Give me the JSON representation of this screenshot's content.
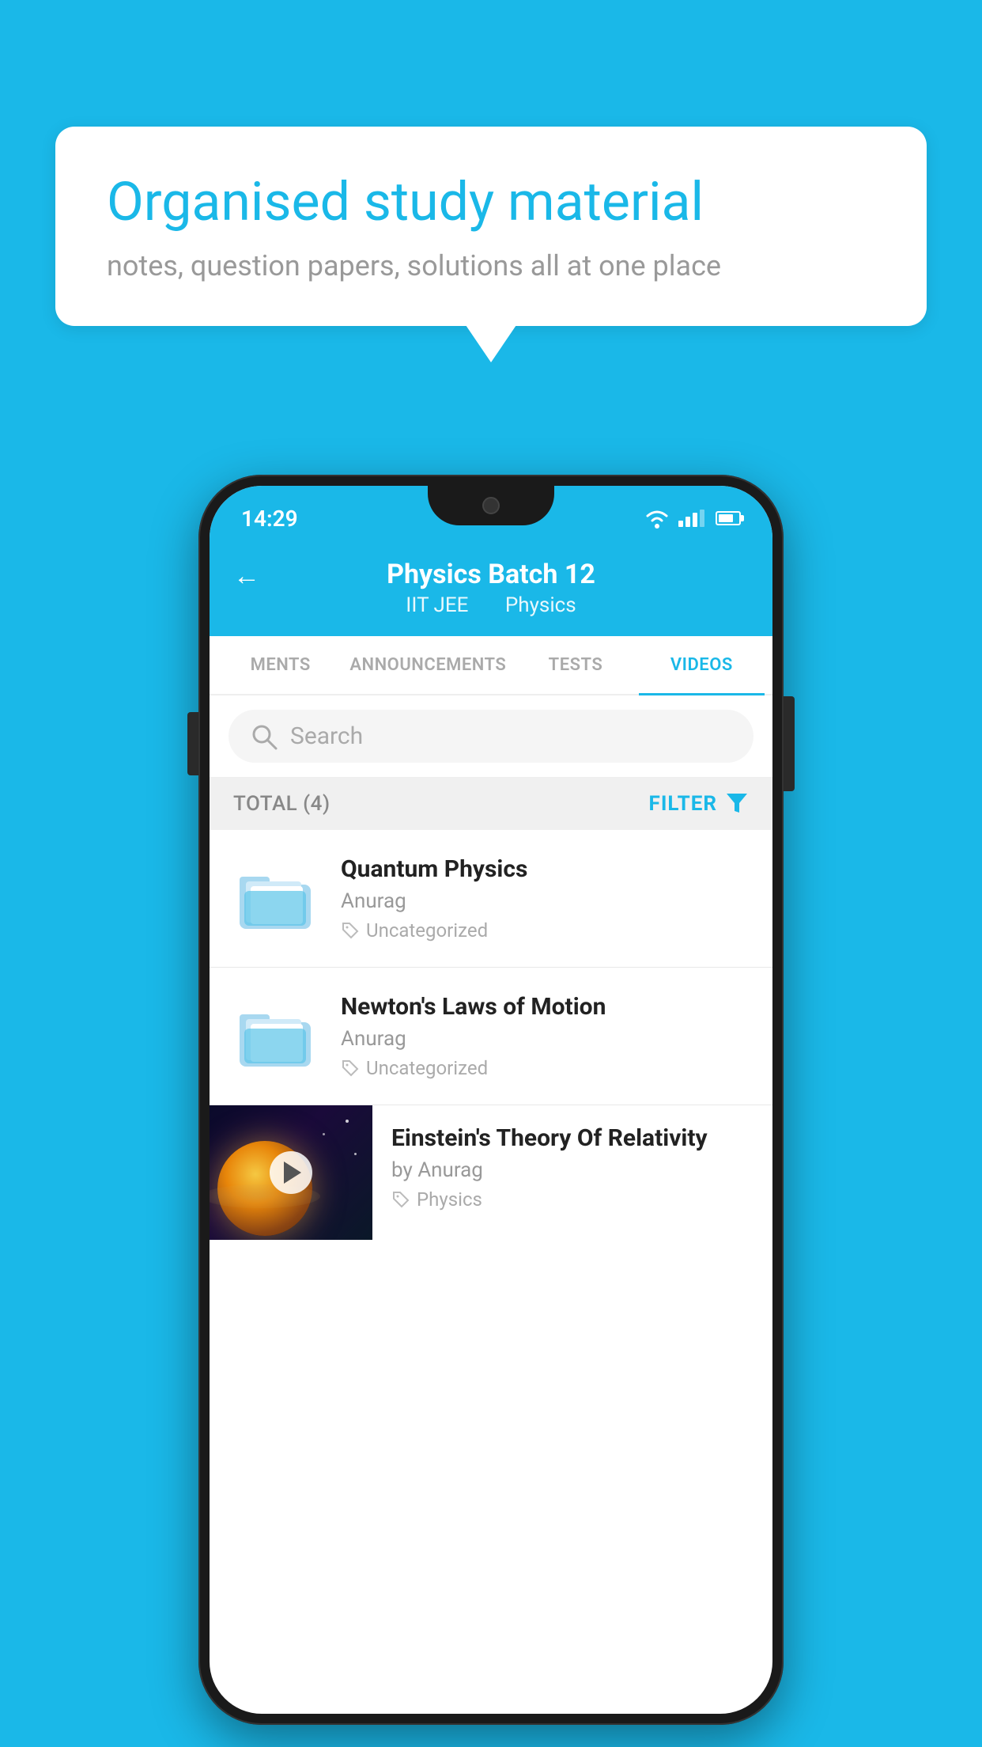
{
  "background_color": "#1ab8e8",
  "speech_bubble": {
    "title": "Organised study material",
    "subtitle": "notes, question papers, solutions all at one place"
  },
  "phone": {
    "status_bar": {
      "time": "14:29"
    },
    "header": {
      "title": "Physics Batch 12",
      "subtitle_left": "IIT JEE",
      "subtitle_right": "Physics",
      "back_label": "←"
    },
    "tabs": [
      {
        "label": "MENTS",
        "active": false
      },
      {
        "label": "ANNOUNCEMENTS",
        "active": false
      },
      {
        "label": "TESTS",
        "active": false
      },
      {
        "label": "VIDEOS",
        "active": true
      }
    ],
    "search": {
      "placeholder": "Search"
    },
    "filter_bar": {
      "total": "TOTAL (4)",
      "filter_label": "FILTER"
    },
    "videos": [
      {
        "id": 1,
        "title": "Quantum Physics",
        "author": "Anurag",
        "tag": "Uncategorized",
        "type": "folder"
      },
      {
        "id": 2,
        "title": "Newton's Laws of Motion",
        "author": "Anurag",
        "tag": "Uncategorized",
        "type": "folder"
      },
      {
        "id": 3,
        "title": "Einstein's Theory Of Relativity",
        "author": "by Anurag",
        "tag": "Physics",
        "type": "video"
      }
    ]
  }
}
